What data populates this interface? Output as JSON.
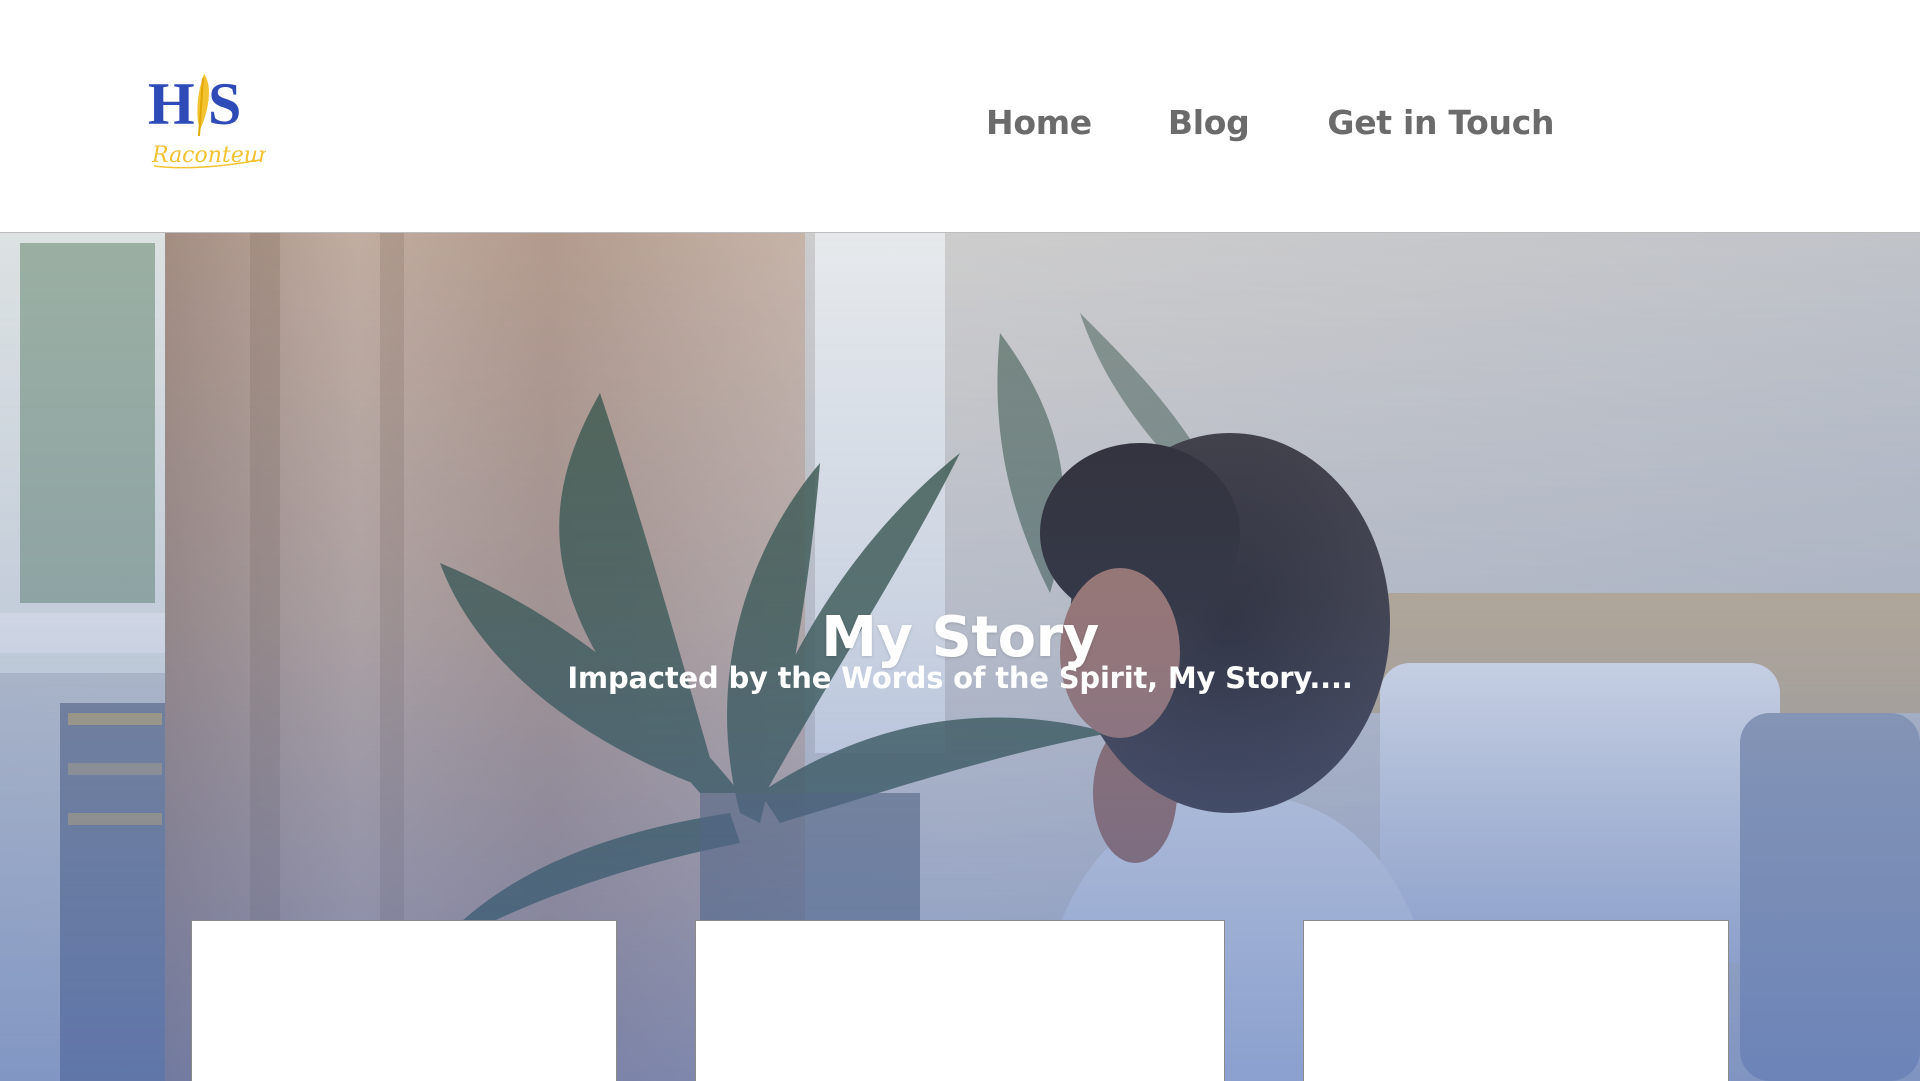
{
  "brand": {
    "logo_main": "HIS",
    "logo_script": "Raconteur",
    "colors": {
      "blue": "#2e4bb8",
      "gold": "#f2c230"
    }
  },
  "nav": {
    "items": [
      {
        "label": "Home"
      },
      {
        "label": "Blog"
      },
      {
        "label": "Get in Touch"
      }
    ]
  },
  "hero": {
    "title": "My Story",
    "subtitle": "Impacted by the Words of the Spirit, My Story....",
    "overlay_color": "#4a6ab8"
  },
  "cards": [
    {
      "content": ""
    },
    {
      "content": ""
    },
    {
      "content": ""
    }
  ]
}
